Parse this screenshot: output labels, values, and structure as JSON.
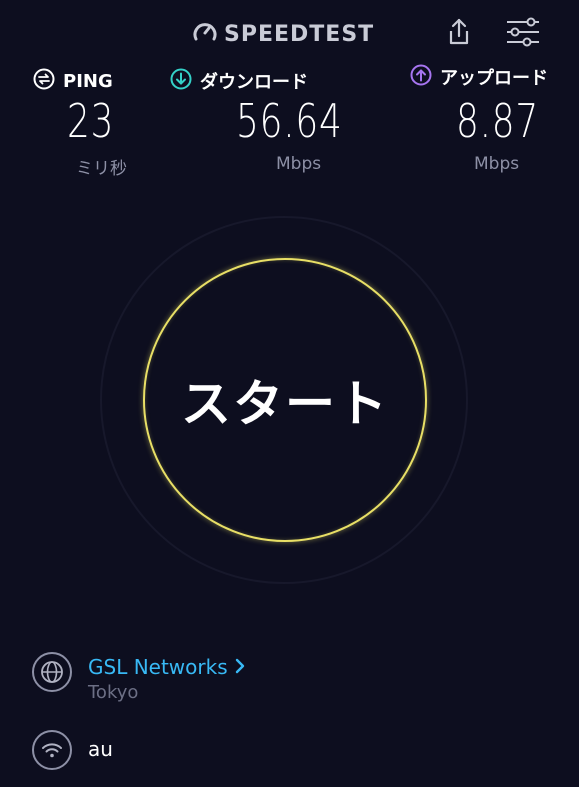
{
  "header": {
    "logo_text": "SPEEDTEST",
    "icons": {
      "logo": "gauge-icon",
      "share": "share-icon",
      "settings": "sliders-icon"
    }
  },
  "metrics": {
    "ping": {
      "label": "PING",
      "value": "23",
      "unit": "ミリ秒",
      "icon": "ping-icon",
      "color": "#ffffff"
    },
    "download": {
      "label": "ダウンロード",
      "value": "56.64",
      "unit": "Mbps",
      "icon": "download-icon",
      "color": "#34d1c8"
    },
    "upload": {
      "label": "アップロード",
      "value": "8.87",
      "unit": "Mbps",
      "icon": "upload-icon",
      "color": "#a775f0"
    }
  },
  "start_button": {
    "label": "スタート",
    "ring_color": "#e8df66"
  },
  "server": {
    "name": "GSL Networks",
    "location": "Tokyo",
    "icon": "globe-icon",
    "link_color": "#38b9f5"
  },
  "connection": {
    "name": "au",
    "icon": "wifi-icon"
  }
}
